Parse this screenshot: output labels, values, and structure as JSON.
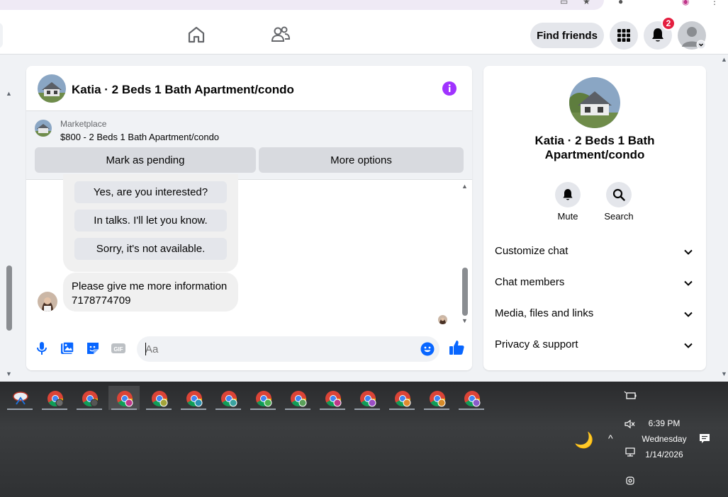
{
  "browser": {
    "url_fragment": ""
  },
  "header": {
    "find_friends_label": "Find friends",
    "notification_count": "2"
  },
  "chat": {
    "title": "Katia · 2 Beds 1 Bath Apartment/condo",
    "marketplace_label": "Marketplace",
    "listing_price_title": "$800 - 2 Beds 1 Bath Apartment/condo",
    "mark_pending_label": "Mark as pending",
    "more_options_label": "More options",
    "quick_replies": [
      "Yes, are you interested?",
      "In talks. I'll let you know.",
      "Sorry, it's not available."
    ],
    "message_line1": "Please give me more information",
    "message_line2": "7178774709",
    "input_placeholder": "Aa"
  },
  "info": {
    "title": "Katia · 2 Beds 1 Bath Apartment/condo",
    "actions": [
      {
        "label": "Mute",
        "icon": "bell-icon"
      },
      {
        "label": "Search",
        "icon": "search-icon"
      }
    ],
    "sections": [
      "Customize chat",
      "Chat members",
      "Media, files and links",
      "Privacy & support"
    ]
  },
  "taskbar": {
    "time": "6:39 PM",
    "day": "Wednesday",
    "date": "1/14/2026"
  },
  "colors": {
    "accent_blue": "#0866ff",
    "info_purple": "#a033ff",
    "badge_red": "#e41e3f"
  }
}
